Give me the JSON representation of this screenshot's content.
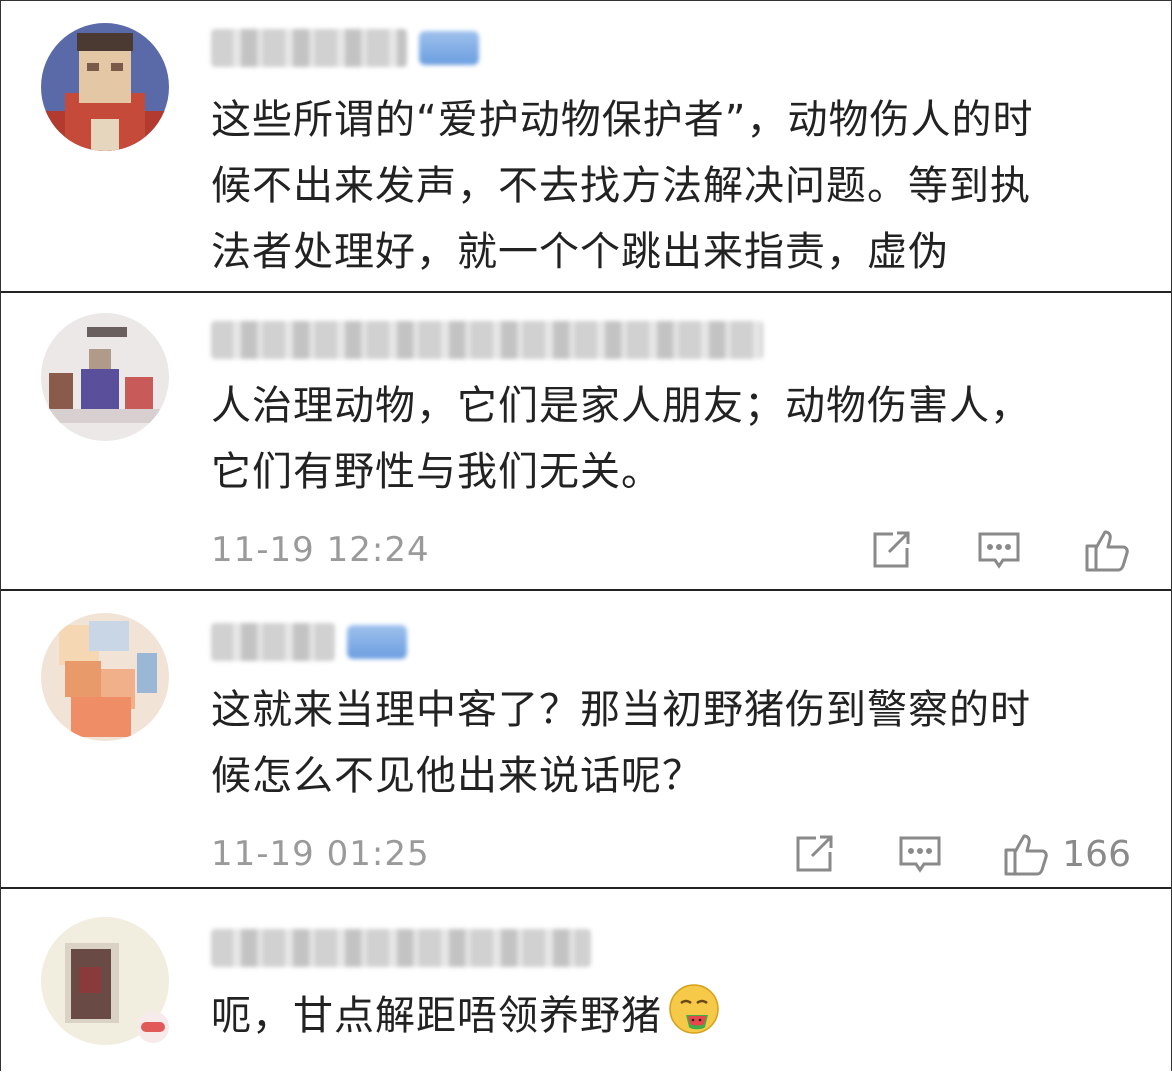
{
  "comments": [
    {
      "id": "c1",
      "text_lines": [
        "这些所谓的“爱护动物保护者”，动物伤人的时",
        "候不出来发声，不去找方法解决问题。等到执",
        "法者处理好，就一个个跳出来指责，虚伪"
      ],
      "time": "",
      "likes": ""
    },
    {
      "id": "c2",
      "text_lines": [
        "人治理动物，它们是家人朋友；动物伤害人，",
        "它们有野性与我们无关。"
      ],
      "time": "11-19 12:24",
      "likes": ""
    },
    {
      "id": "c3",
      "text_lines": [
        "这就来当理中客了？那当初野猪伤到警察的时",
        "候怎么不见他出来说话呢？"
      ],
      "time": "11-19 01:25",
      "likes": "166"
    },
    {
      "id": "c4",
      "text_lines": [
        "呃，甘点解距唔领养野猪"
      ],
      "time": "",
      "likes": ""
    }
  ],
  "icons": {
    "share": "share-icon",
    "reply": "comment-icon",
    "like": "thumbs-up-icon",
    "emoji": "watermelon-face-emoji"
  },
  "colors": {
    "text": "#222222",
    "meta": "#9a9a9a",
    "icon": "#8a8a8a",
    "vip_badge": "#7aa7e6",
    "divider": "#222222"
  }
}
